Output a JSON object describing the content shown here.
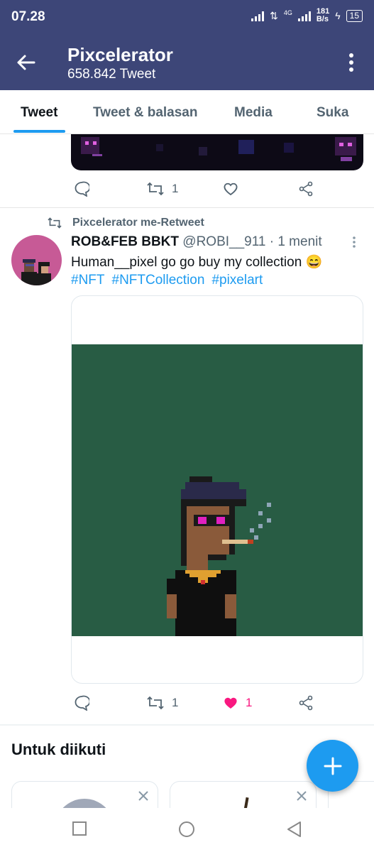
{
  "status_bar": {
    "time": "07.28",
    "network": "4G",
    "speed_value": "181",
    "speed_unit": "B/s",
    "battery": "15"
  },
  "header": {
    "title": "Pixcelerator",
    "subtitle": "658.842 Tweet"
  },
  "tabs": [
    {
      "label": "Tweet",
      "active": true
    },
    {
      "label": "Tweet & balasan",
      "active": false
    },
    {
      "label": "Media",
      "active": false
    },
    {
      "label": "Suka",
      "active": false
    }
  ],
  "prev_tweet": {
    "retweets": "1"
  },
  "tweet": {
    "retweet_label": "Pixcelerator me-Retweet",
    "name": "ROB&FEB BBKT",
    "handle": "@ROBI__911",
    "time": "· 1 menit",
    "text": "Human__pixel go go buy my collection 😄",
    "hashtags": [
      "#NFT",
      "#NFTCollection",
      "#pixelart"
    ],
    "retweets": "1",
    "likes": "1"
  },
  "follow_section": {
    "title": "Untuk diikuti"
  },
  "colors": {
    "bar": "#3d4678",
    "accent": "#1d9bf0",
    "like": "#f91880",
    "media_bg": "#285c44"
  }
}
